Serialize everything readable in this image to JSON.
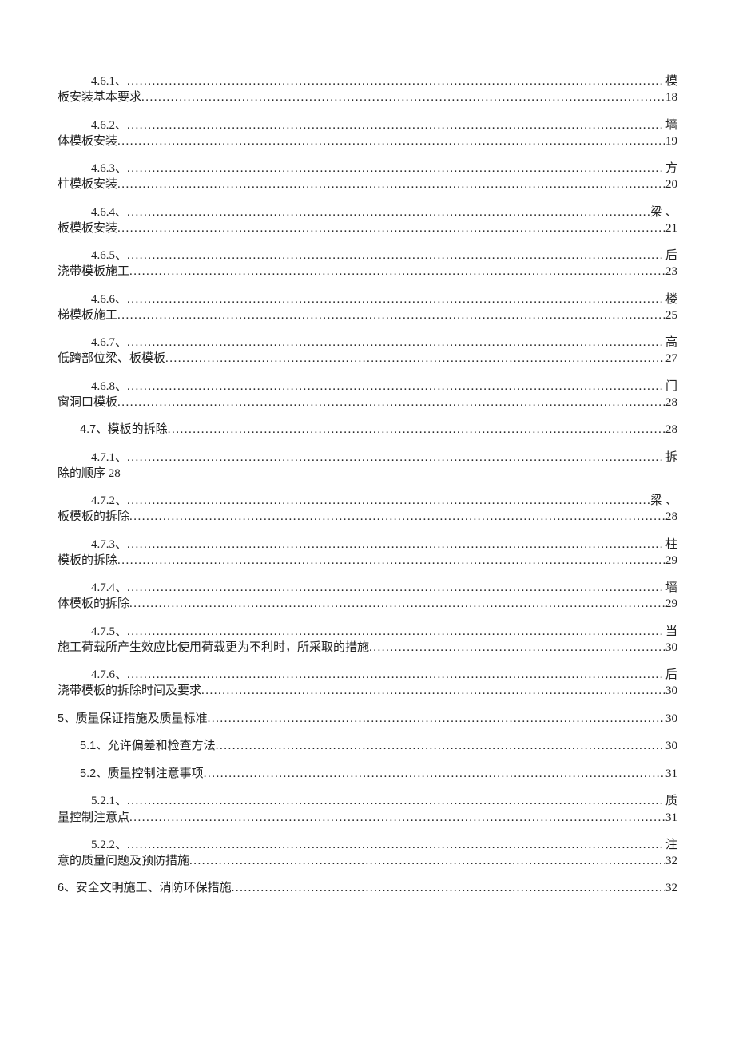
{
  "toc": [
    {
      "indent": 2,
      "num": "4.6.1、",
      "trail": "模",
      "cont_lead": "板安装基本要求",
      "cont_trail": "18"
    },
    {
      "indent": 2,
      "num": "4.6.2、",
      "trail": "墙",
      "cont_lead": "体模板安装",
      "cont_trail": "19"
    },
    {
      "indent": 2,
      "num": "4.6.3、",
      "trail": "方",
      "cont_lead": "柱模板安装",
      "cont_trail": "20"
    },
    {
      "indent": 2,
      "num": "4.6.4、",
      "trail": "梁 、",
      "cont_lead": "板模板安装",
      "cont_trail": "21"
    },
    {
      "indent": 2,
      "num": "4.6.5、",
      "trail": "后",
      "cont_lead": "浇带模板施工",
      "cont_trail": "23"
    },
    {
      "indent": 2,
      "num": "4.6.6、",
      "trail": "楼",
      "cont_lead": "梯模板施工",
      "cont_trail": "25"
    },
    {
      "indent": 2,
      "num": "4.6.7、",
      "trail": "高",
      "cont_lead": "低跨部位梁、板模板",
      "cont_trail": "27"
    },
    {
      "indent": 2,
      "num": "4.6.8、",
      "trail": "门",
      "cont_lead": "窗洞口模板",
      "cont_trail": "28"
    },
    {
      "single": true,
      "indent": 1,
      "num_sans": "4.7、 ",
      "lead": "模板的拆除",
      "trail": "28"
    },
    {
      "indent": 2,
      "num": "4.7.1、",
      "trail": "拆",
      "cont_lead": "除的顺序 28",
      "nodots": true
    },
    {
      "indent": 2,
      "num": "4.7.2、",
      "trail": "梁 、",
      "cont_lead": "板模板的拆除",
      "cont_trail": "28"
    },
    {
      "indent": 2,
      "num": "4.7.3、",
      "trail": "柱",
      "cont_lead": "模板的拆除",
      "cont_trail": "29"
    },
    {
      "indent": 2,
      "num": "4.7.4、",
      "trail": "墙",
      "cont_lead": "体模板的拆除",
      "cont_trail": "29"
    },
    {
      "indent": 2,
      "num": "4.7.5、",
      "trail": "当",
      "cont_lead": "施工荷载所产生效应比使用荷载更为不利时，所采取的措施",
      "cont_trail": "30"
    },
    {
      "indent": 2,
      "num": "4.7.6、",
      "trail": "后",
      "cont_lead": "浇带模板的拆除时间及要求",
      "cont_trail": "30"
    },
    {
      "single": true,
      "indent": 0,
      "num_sans": "5、",
      "lead": "质量保证措施及质量标准",
      "trail": "30"
    },
    {
      "single": true,
      "indent": 1,
      "num_sans": "5.1、 ",
      "lead": "允许偏差和检查方法",
      "trail": "30"
    },
    {
      "single": true,
      "indent": 1,
      "num_sans": "5.2、 ",
      "lead": "质量控制注意事项",
      "trail": "31"
    },
    {
      "indent": 2,
      "num": "5.2.1、",
      "trail": "质",
      "cont_lead": "量控制注意点",
      "cont_trail": "31"
    },
    {
      "indent": 2,
      "num": "5.2.2、",
      "trail": "注",
      "cont_lead": "意的质量问题及预防措施",
      "cont_trail": "32"
    },
    {
      "single": true,
      "indent": 0,
      "num_sans": "6、",
      "lead": "安全文明施工、消防环保措施",
      "trail": "32"
    }
  ]
}
